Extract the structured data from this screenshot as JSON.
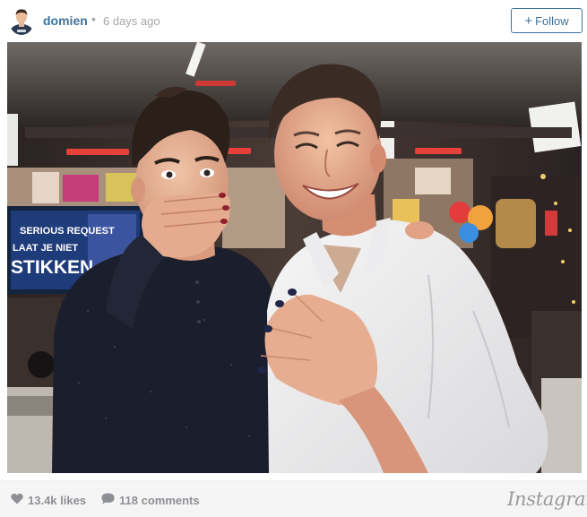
{
  "post": {
    "username": "domien",
    "separator": "•",
    "time_ago": "6 days ago",
    "follow_label": "Follow",
    "follow_plus": "+"
  },
  "photo": {
    "banner_line1": "LAAT JE NIET",
    "banner_line2": "STIKKEN",
    "banner_top": "SERIOUS REQUEST"
  },
  "footer": {
    "likes": "13.4k likes",
    "comments": "118 comments",
    "brand": "Instagram"
  },
  "colors": {
    "link": "#3f729b",
    "muted": "#a5a7aa",
    "footer_text": "#8e9095",
    "footer_bg": "#f5f5f5"
  },
  "icons": {
    "heart": "heart-icon",
    "comment": "comment-bubble-icon"
  }
}
